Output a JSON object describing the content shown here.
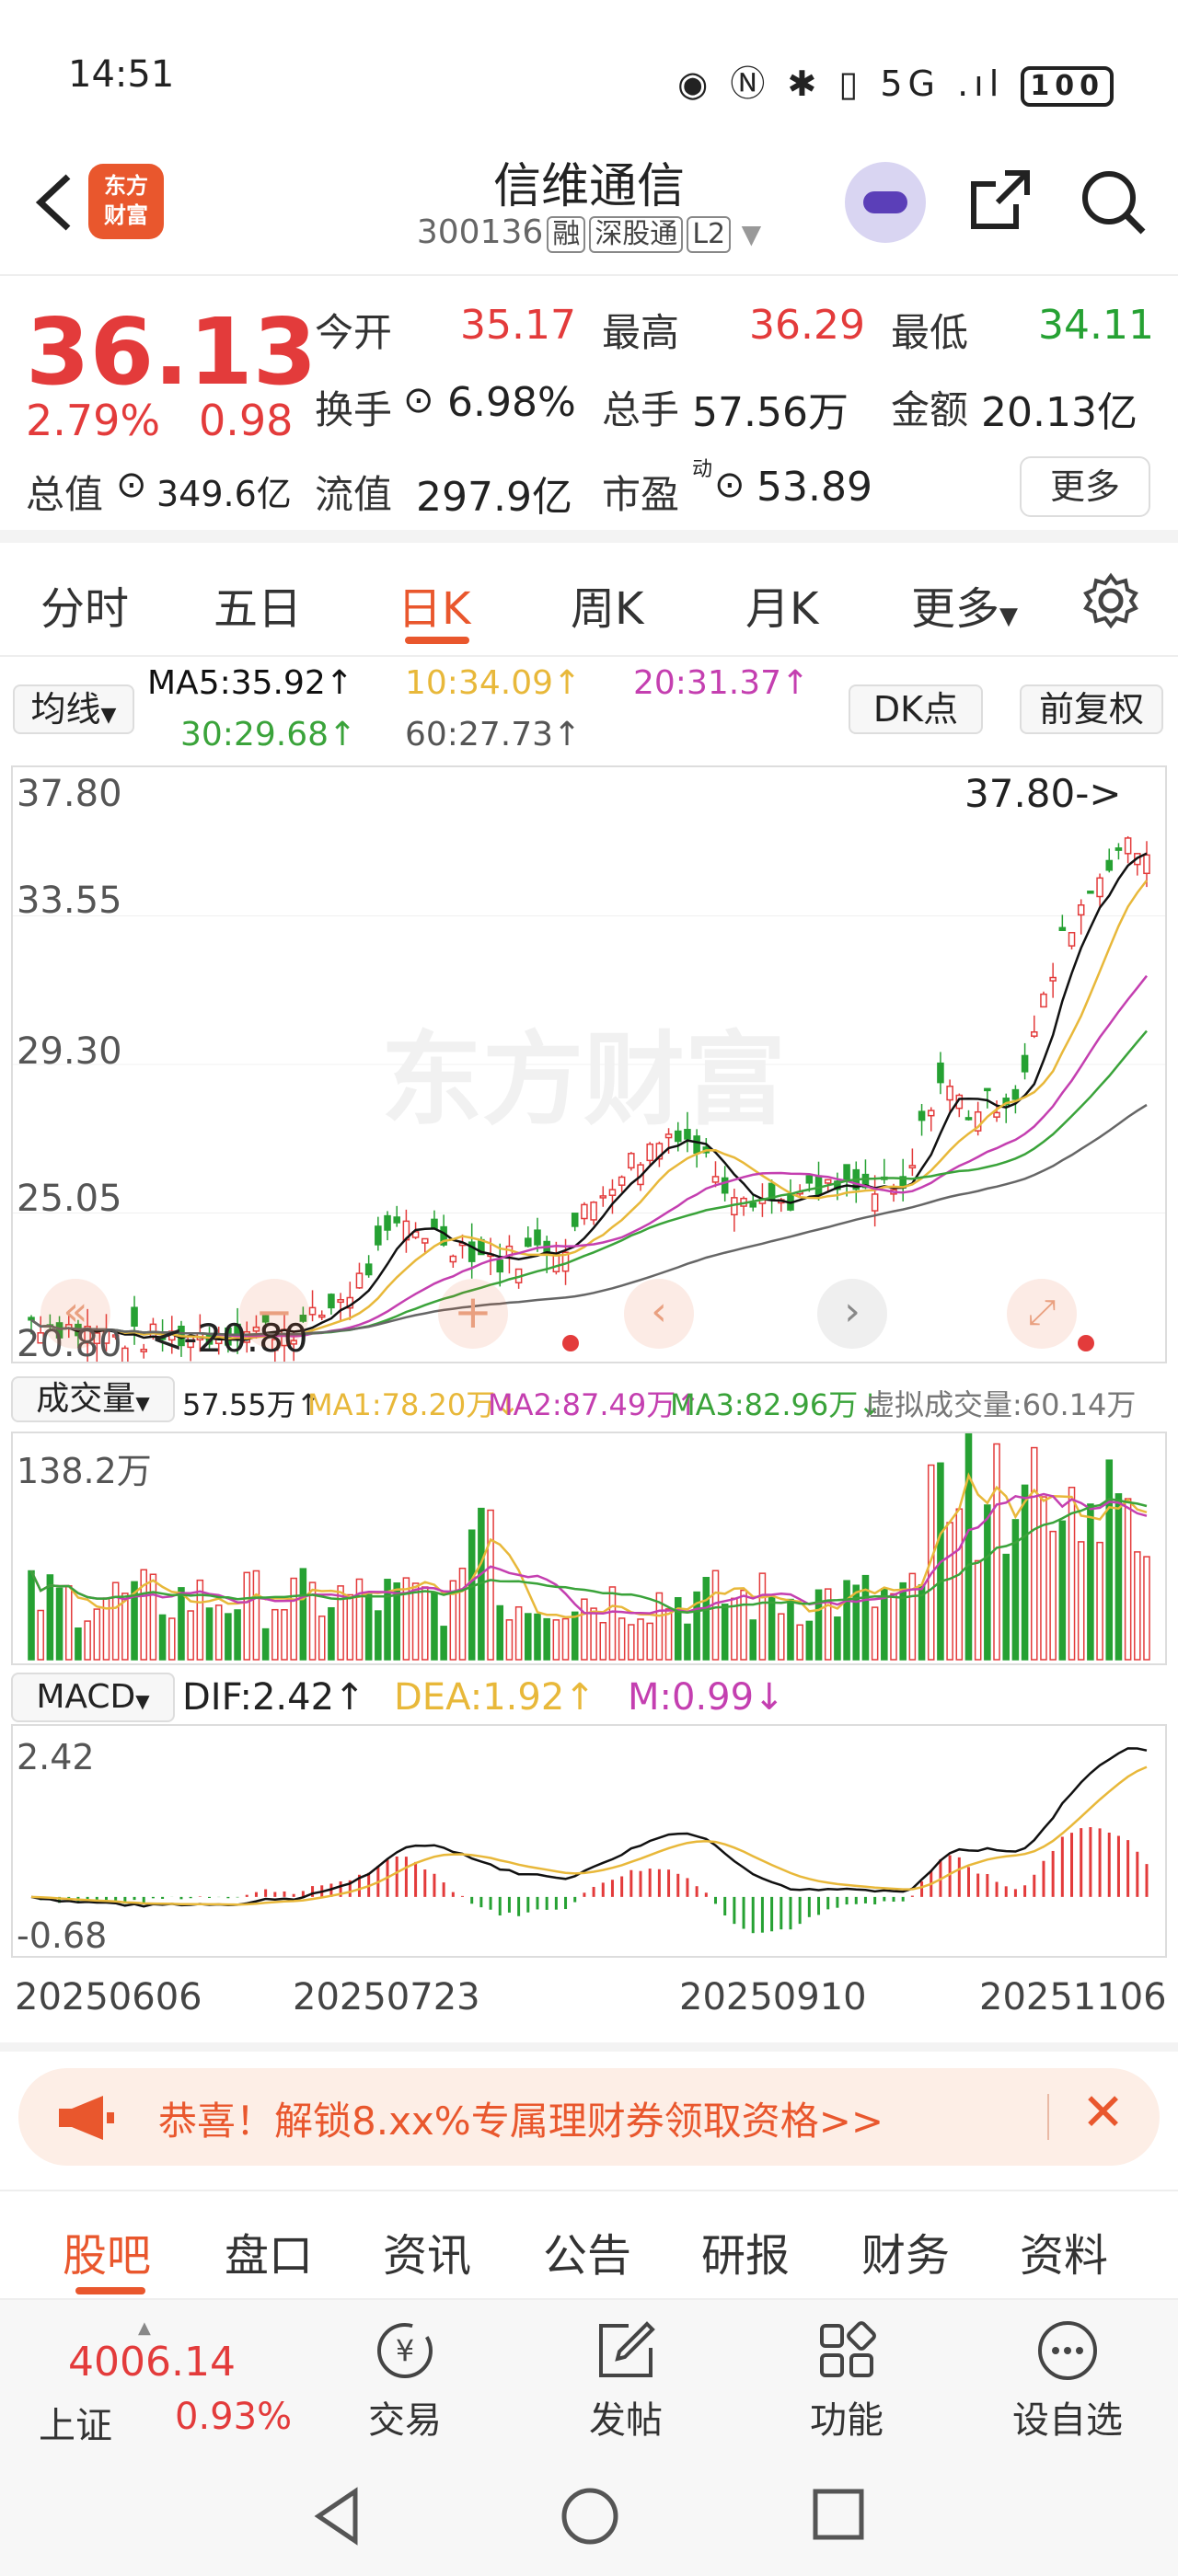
{
  "status_bar": {
    "time": "14:51",
    "icons": "◉ Ⓝ ✱ ▯ 5G .ıl",
    "battery": "100"
  },
  "header": {
    "back_icon": "chevron-left-icon",
    "logo_text_1": "东方",
    "logo_text_2": "财富",
    "stock_name": "信维通信",
    "stock_code": "300136",
    "tags": [
      "融",
      "深股通",
      "L2"
    ]
  },
  "quote": {
    "price": "36.13",
    "change_pct": "2.79%",
    "change_abs": "0.98",
    "open_label": "今开",
    "open": "35.17",
    "high_label": "最高",
    "high": "36.29",
    "low_label": "最低",
    "low": "34.11",
    "turnover_label": "换手",
    "turnover": "6.98%",
    "volume_label": "总手",
    "volume": "57.56万",
    "amount_label": "金额",
    "amount": "20.13亿",
    "mcap_label": "总值",
    "mcap": "349.6亿",
    "float_label": "流值",
    "float": "297.9亿",
    "pe_label": "市盈",
    "pe_sup": "动",
    "pe": "53.89",
    "more_button": "更多"
  },
  "period_tabs": [
    "分时",
    "五日",
    "日K",
    "周K",
    "月K",
    "更多"
  ],
  "active_period": "日K",
  "ma_row": {
    "selector": "均线",
    "ma5": "MA5:35.92↑",
    "ma10": "10:34.09↑",
    "ma20": "20:31.37↑",
    "ma30": "30:29.68↑",
    "ma60": "60:27.73↑",
    "dk_button": "DK点",
    "fq_button": "前复权"
  },
  "kline": {
    "y_labels": [
      "37.80",
      "33.55",
      "29.30",
      "25.05",
      "20.80"
    ],
    "max_marker": "37.80->",
    "min_marker": "<-20.80",
    "watermark": "东方财富"
  },
  "volume_header": {
    "selector": "成交量",
    "vol": "57.55万↑",
    "ma1": "MA1:78.20万↓",
    "ma2": "MA2:87.49万↑",
    "ma3": "MA3:82.96万↓",
    "virtual": "虚拟成交量:60.14万",
    "max_label": "138.2万"
  },
  "macd_header": {
    "selector": "MACD",
    "dif": "DIF:2.42↑",
    "dea": "DEA:1.92↑",
    "m": "M:0.99↓",
    "top_label": "2.42",
    "bottom_label": "-0.68"
  },
  "dates": [
    "20250606",
    "20250723",
    "20250910",
    "20251106"
  ],
  "banner": {
    "text": "恭喜！解锁8.xx%专属理财券领取资格>>"
  },
  "bottom_tabs": [
    "股吧",
    "盘口",
    "资讯",
    "公告",
    "研报",
    "财务",
    "资料"
  ],
  "bottom_nav": {
    "index_value": "4006.14",
    "index_name": "上证",
    "index_change": "0.93%",
    "items": [
      "交易",
      "发帖",
      "功能",
      "设自选"
    ]
  },
  "colors": {
    "up": "#e33b3b",
    "down": "#26a133",
    "accent": "#e9572d",
    "ma5": "#111111",
    "ma10": "#e8b83a",
    "ma20": "#c43fb0",
    "ma30": "#3aa33a",
    "ma60": "#666666"
  }
}
